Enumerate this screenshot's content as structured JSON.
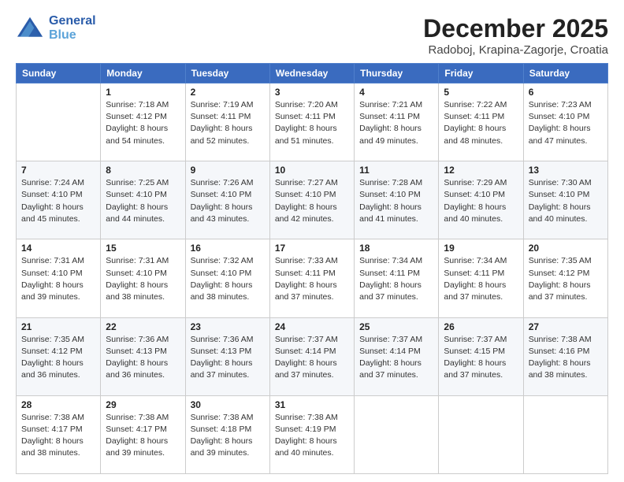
{
  "header": {
    "logo_line1": "General",
    "logo_line2": "Blue",
    "month": "December 2025",
    "location": "Radoboj, Krapina-Zagorje, Croatia"
  },
  "weekdays": [
    "Sunday",
    "Monday",
    "Tuesday",
    "Wednesday",
    "Thursday",
    "Friday",
    "Saturday"
  ],
  "weeks": [
    [
      {
        "day": "",
        "sunrise": "",
        "sunset": "",
        "daylight": ""
      },
      {
        "day": "1",
        "sunrise": "Sunrise: 7:18 AM",
        "sunset": "Sunset: 4:12 PM",
        "daylight": "Daylight: 8 hours and 54 minutes."
      },
      {
        "day": "2",
        "sunrise": "Sunrise: 7:19 AM",
        "sunset": "Sunset: 4:11 PM",
        "daylight": "Daylight: 8 hours and 52 minutes."
      },
      {
        "day": "3",
        "sunrise": "Sunrise: 7:20 AM",
        "sunset": "Sunset: 4:11 PM",
        "daylight": "Daylight: 8 hours and 51 minutes."
      },
      {
        "day": "4",
        "sunrise": "Sunrise: 7:21 AM",
        "sunset": "Sunset: 4:11 PM",
        "daylight": "Daylight: 8 hours and 49 minutes."
      },
      {
        "day": "5",
        "sunrise": "Sunrise: 7:22 AM",
        "sunset": "Sunset: 4:11 PM",
        "daylight": "Daylight: 8 hours and 48 minutes."
      },
      {
        "day": "6",
        "sunrise": "Sunrise: 7:23 AM",
        "sunset": "Sunset: 4:10 PM",
        "daylight": "Daylight: 8 hours and 47 minutes."
      }
    ],
    [
      {
        "day": "7",
        "sunrise": "Sunrise: 7:24 AM",
        "sunset": "Sunset: 4:10 PM",
        "daylight": "Daylight: 8 hours and 45 minutes."
      },
      {
        "day": "8",
        "sunrise": "Sunrise: 7:25 AM",
        "sunset": "Sunset: 4:10 PM",
        "daylight": "Daylight: 8 hours and 44 minutes."
      },
      {
        "day": "9",
        "sunrise": "Sunrise: 7:26 AM",
        "sunset": "Sunset: 4:10 PM",
        "daylight": "Daylight: 8 hours and 43 minutes."
      },
      {
        "day": "10",
        "sunrise": "Sunrise: 7:27 AM",
        "sunset": "Sunset: 4:10 PM",
        "daylight": "Daylight: 8 hours and 42 minutes."
      },
      {
        "day": "11",
        "sunrise": "Sunrise: 7:28 AM",
        "sunset": "Sunset: 4:10 PM",
        "daylight": "Daylight: 8 hours and 41 minutes."
      },
      {
        "day": "12",
        "sunrise": "Sunrise: 7:29 AM",
        "sunset": "Sunset: 4:10 PM",
        "daylight": "Daylight: 8 hours and 40 minutes."
      },
      {
        "day": "13",
        "sunrise": "Sunrise: 7:30 AM",
        "sunset": "Sunset: 4:10 PM",
        "daylight": "Daylight: 8 hours and 40 minutes."
      }
    ],
    [
      {
        "day": "14",
        "sunrise": "Sunrise: 7:31 AM",
        "sunset": "Sunset: 4:10 PM",
        "daylight": "Daylight: 8 hours and 39 minutes."
      },
      {
        "day": "15",
        "sunrise": "Sunrise: 7:31 AM",
        "sunset": "Sunset: 4:10 PM",
        "daylight": "Daylight: 8 hours and 38 minutes."
      },
      {
        "day": "16",
        "sunrise": "Sunrise: 7:32 AM",
        "sunset": "Sunset: 4:10 PM",
        "daylight": "Daylight: 8 hours and 38 minutes."
      },
      {
        "day": "17",
        "sunrise": "Sunrise: 7:33 AM",
        "sunset": "Sunset: 4:11 PM",
        "daylight": "Daylight: 8 hours and 37 minutes."
      },
      {
        "day": "18",
        "sunrise": "Sunrise: 7:34 AM",
        "sunset": "Sunset: 4:11 PM",
        "daylight": "Daylight: 8 hours and 37 minutes."
      },
      {
        "day": "19",
        "sunrise": "Sunrise: 7:34 AM",
        "sunset": "Sunset: 4:11 PM",
        "daylight": "Daylight: 8 hours and 37 minutes."
      },
      {
        "day": "20",
        "sunrise": "Sunrise: 7:35 AM",
        "sunset": "Sunset: 4:12 PM",
        "daylight": "Daylight: 8 hours and 37 minutes."
      }
    ],
    [
      {
        "day": "21",
        "sunrise": "Sunrise: 7:35 AM",
        "sunset": "Sunset: 4:12 PM",
        "daylight": "Daylight: 8 hours and 36 minutes."
      },
      {
        "day": "22",
        "sunrise": "Sunrise: 7:36 AM",
        "sunset": "Sunset: 4:13 PM",
        "daylight": "Daylight: 8 hours and 36 minutes."
      },
      {
        "day": "23",
        "sunrise": "Sunrise: 7:36 AM",
        "sunset": "Sunset: 4:13 PM",
        "daylight": "Daylight: 8 hours and 37 minutes."
      },
      {
        "day": "24",
        "sunrise": "Sunrise: 7:37 AM",
        "sunset": "Sunset: 4:14 PM",
        "daylight": "Daylight: 8 hours and 37 minutes."
      },
      {
        "day": "25",
        "sunrise": "Sunrise: 7:37 AM",
        "sunset": "Sunset: 4:14 PM",
        "daylight": "Daylight: 8 hours and 37 minutes."
      },
      {
        "day": "26",
        "sunrise": "Sunrise: 7:37 AM",
        "sunset": "Sunset: 4:15 PM",
        "daylight": "Daylight: 8 hours and 37 minutes."
      },
      {
        "day": "27",
        "sunrise": "Sunrise: 7:38 AM",
        "sunset": "Sunset: 4:16 PM",
        "daylight": "Daylight: 8 hours and 38 minutes."
      }
    ],
    [
      {
        "day": "28",
        "sunrise": "Sunrise: 7:38 AM",
        "sunset": "Sunset: 4:17 PM",
        "daylight": "Daylight: 8 hours and 38 minutes."
      },
      {
        "day": "29",
        "sunrise": "Sunrise: 7:38 AM",
        "sunset": "Sunset: 4:17 PM",
        "daylight": "Daylight: 8 hours and 39 minutes."
      },
      {
        "day": "30",
        "sunrise": "Sunrise: 7:38 AM",
        "sunset": "Sunset: 4:18 PM",
        "daylight": "Daylight: 8 hours and 39 minutes."
      },
      {
        "day": "31",
        "sunrise": "Sunrise: 7:38 AM",
        "sunset": "Sunset: 4:19 PM",
        "daylight": "Daylight: 8 hours and 40 minutes."
      },
      {
        "day": "",
        "sunrise": "",
        "sunset": "",
        "daylight": ""
      },
      {
        "day": "",
        "sunrise": "",
        "sunset": "",
        "daylight": ""
      },
      {
        "day": "",
        "sunrise": "",
        "sunset": "",
        "daylight": ""
      }
    ]
  ]
}
